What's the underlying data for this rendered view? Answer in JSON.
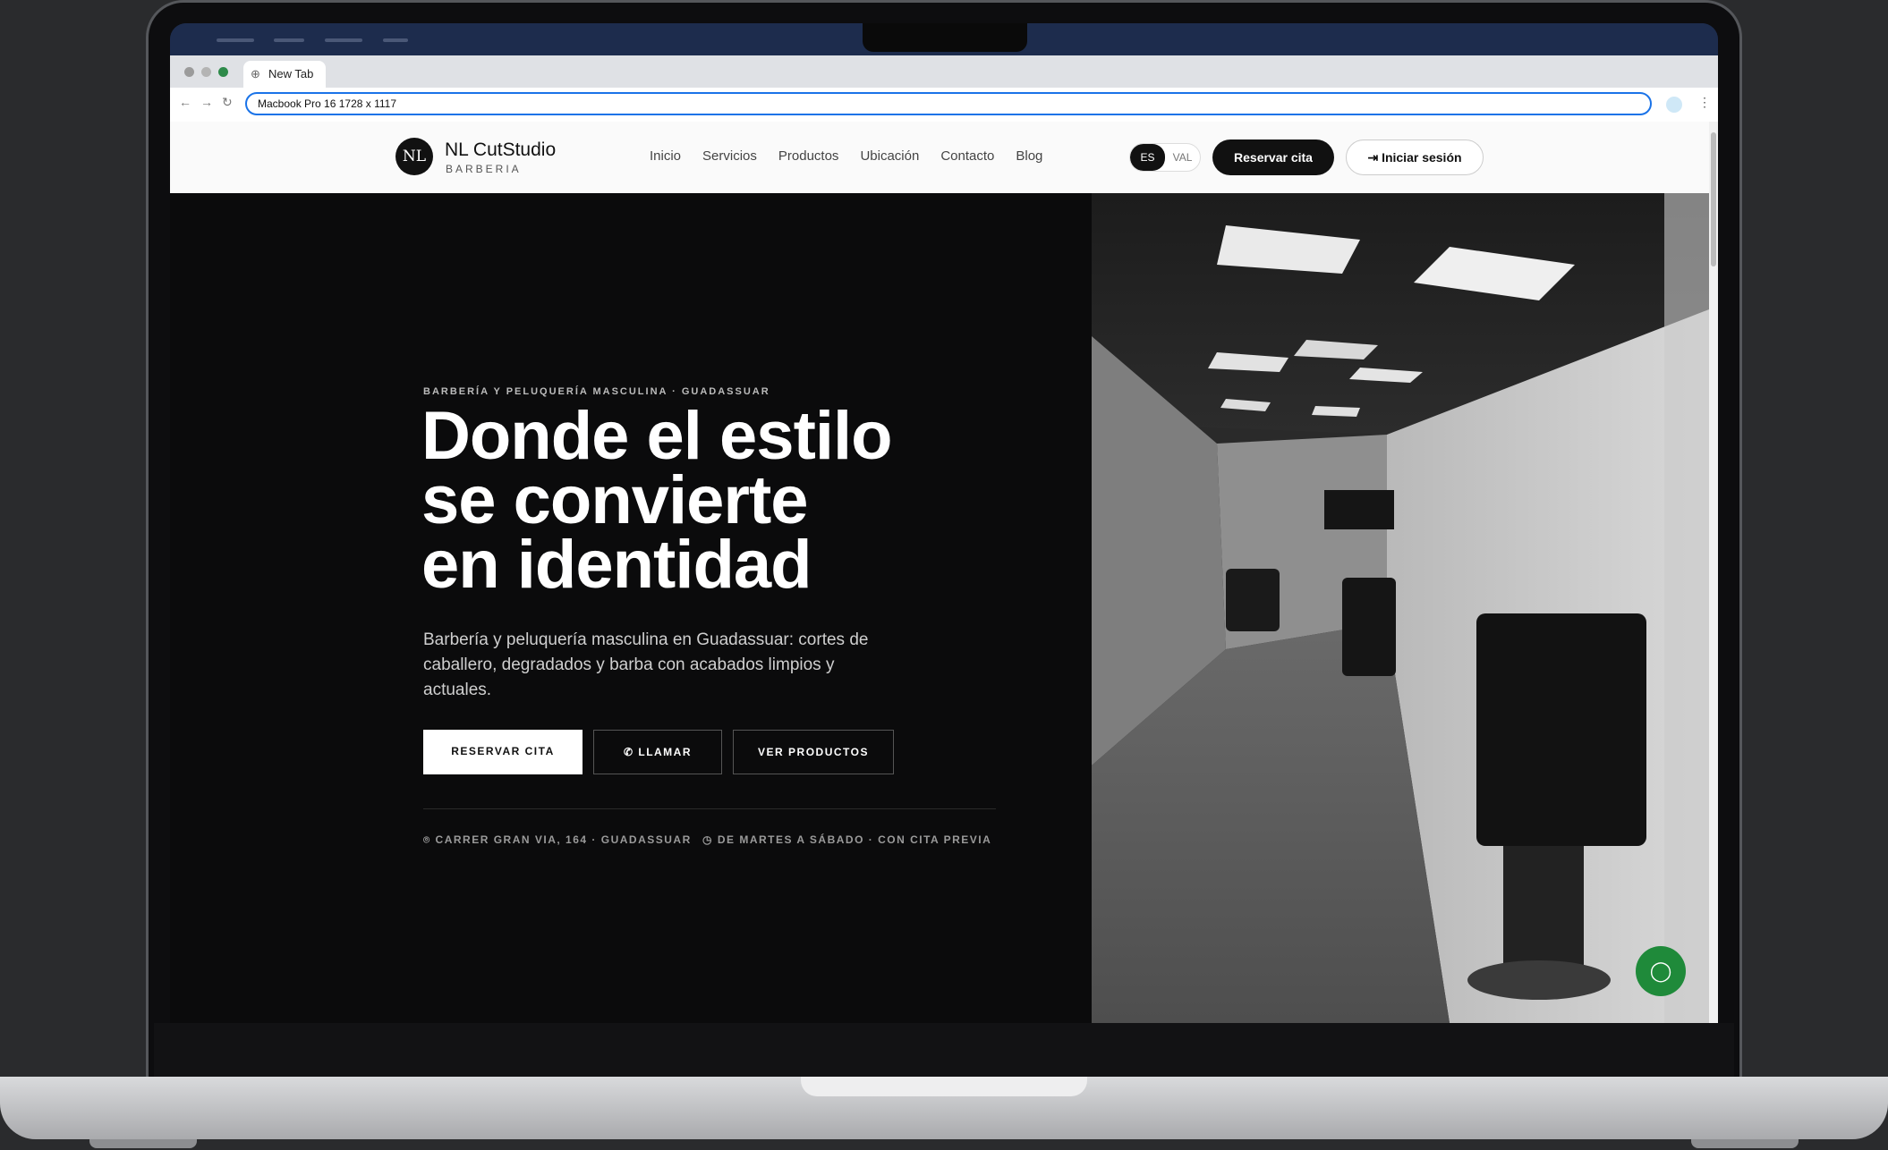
{
  "browser": {
    "tab_title": "New Tab",
    "url_text": "Macbook Pro 16   1728 x 1117"
  },
  "site": {
    "logo_mark": "NL",
    "brand_name": "NL CutStudio",
    "brand_sub": "BARBERIA",
    "nav": [
      "Inicio",
      "Servicios",
      "Productos",
      "Ubicación",
      "Contacto",
      "Blog"
    ],
    "lang_active": "ES",
    "lang_inactive": "VAL",
    "reserve_label": "Reservar cita",
    "login_label": "Iniciar sesión"
  },
  "hero": {
    "eyebrow": "BARBERÍA Y PELUQUERÍA MASCULINA · GUADASSUAR",
    "headline_1": "Donde el estilo",
    "headline_2": "se convierte",
    "headline_3": "en identidad",
    "lead": "Barbería y peluquería masculina en Guadassuar: cortes de caballero, degradados y barba con acabados limpios y actuales.",
    "cta_reserve": "RESERVAR CITA",
    "cta_call": "LLAMAR",
    "cta_products": "VER PRODUCTOS",
    "address": "CARRER GRAN VIA, 164 · GUADASSUAR",
    "hours": "DE MARTES A SÁBADO · CON CITA PREVIA"
  },
  "colors": {
    "accent_dark": "#111111",
    "chat_green": "#1f8a3a",
    "url_focus": "#1a73e8"
  }
}
